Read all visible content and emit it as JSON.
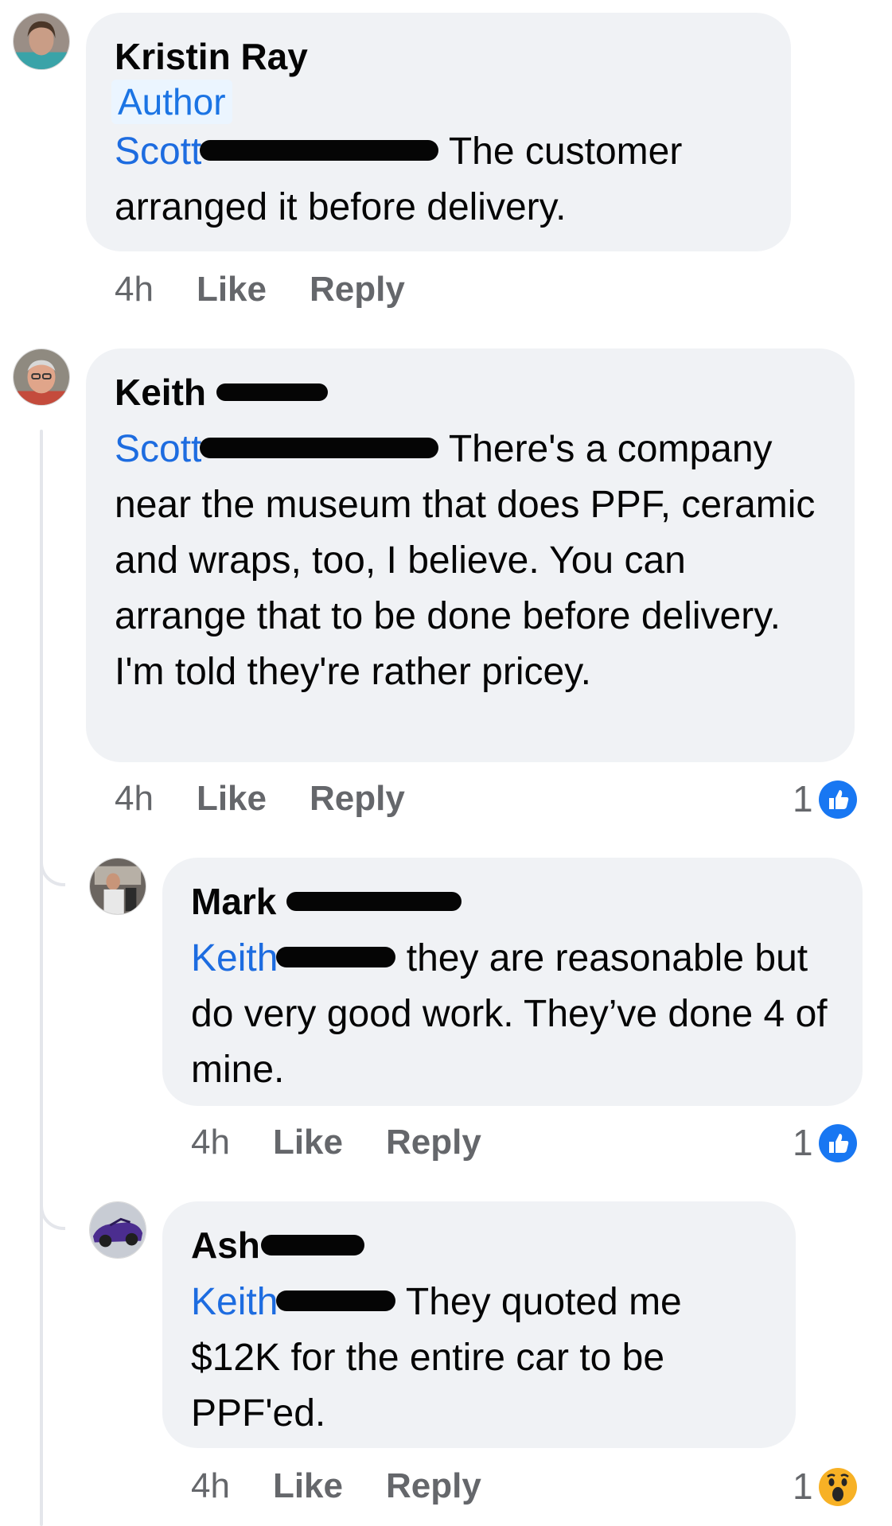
{
  "comments": [
    {
      "author": "Kristin Ray",
      "badge": "Author",
      "mention": "Scott",
      "text": " The customer arranged it before delivery.",
      "time": "4h",
      "like": "Like",
      "reply": "Reply",
      "reaction_count": null
    },
    {
      "author": "Keith",
      "mention": "Scott",
      "text": " There's a company near the museum that does PPF, ceramic and wraps, too, I believe. You can arrange that to be done before delivery. I'm told they're rather pricey.",
      "time": "4h",
      "like": "Like",
      "reply": "Reply",
      "reaction_count": "1",
      "reaction_icon": "like-icon"
    },
    {
      "author": "Mark",
      "mention": "Keith",
      "text": " they are reasonable but do very good work. They’ve done 4 of mine.",
      "time": "4h",
      "like": "Like",
      "reply": "Reply",
      "reaction_count": "1",
      "reaction_icon": "like-icon"
    },
    {
      "author": "Ash",
      "mention": "Keith",
      "text": " They quoted me $12K for the entire car to be PPF'ed.",
      "time": "4h",
      "like": "Like",
      "reply": "Reply",
      "reaction_count": "1",
      "reaction_icon": "wow-icon"
    }
  ],
  "colors": {
    "bubble": "#f0f2f5",
    "mention": "#1d6ce0",
    "like_blue": "#1877f2",
    "wow_yellow": "#f7b125",
    "meta_gray": "#65676b"
  }
}
